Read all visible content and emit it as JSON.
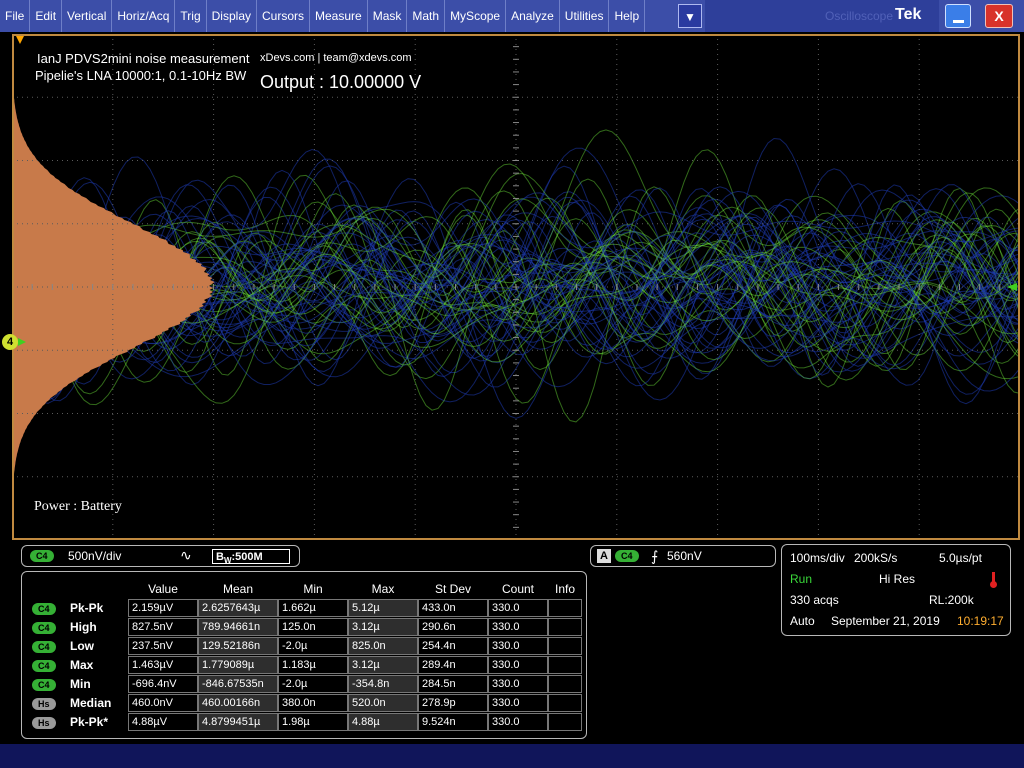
{
  "menu": {
    "items": [
      "File",
      "Edit",
      "Vertical",
      "Horiz/Acq",
      "Trig",
      "Display",
      "Cursors",
      "Measure",
      "Mask",
      "Math",
      "MyScope",
      "Analyze",
      "Utilities",
      "Help"
    ],
    "dropdown_symbol": "▼",
    "ghost_label": "Oscilloscope",
    "logo": "Tek",
    "close_symbol": "X"
  },
  "overlay": {
    "title_line1": "IanJ PDVS2mini noise measurement",
    "title_line2": "Pipelie's LNA 10000:1, 0.1-10Hz BW",
    "credit": "xDevs.com | team@xdevs.com",
    "output": "Output : 10.00000 V",
    "power": "Power : Battery",
    "channel_marker": "4"
  },
  "channel": {
    "chip": "C4",
    "scale": "500nV/div",
    "wave_symbol": "∿",
    "bw_prefix": "B",
    "bw_sub": "W",
    "bw_value": ":500M"
  },
  "trigger": {
    "source_letter": "A",
    "chip": "C4",
    "edge_symbol": "⨍",
    "level": "560nV"
  },
  "acquisition": {
    "timebase": "100ms/div",
    "sample_rate": "200kS/s",
    "per_point": "5.0µs/pt",
    "state": "Run",
    "mode": "Hi Res",
    "acqs": "330 acqs",
    "record_length": "RL:200k",
    "trigger_mode": "Auto",
    "date": "September 21, 2019",
    "time": "10:19:17"
  },
  "measurements": {
    "headers": [
      "Value",
      "Mean",
      "Min",
      "Max",
      "St Dev",
      "Count",
      "Info"
    ],
    "rows": [
      {
        "source": "C4",
        "kind": "c4",
        "name": "Pk-Pk",
        "value": "2.159µV",
        "mean": "2.6257643µ",
        "min": "1.662µ",
        "max": "5.12µ",
        "stdev": "433.0n",
        "count": "330.0",
        "info": ""
      },
      {
        "source": "C4",
        "kind": "c4",
        "name": "High",
        "value": "827.5nV",
        "mean": "789.94661n",
        "min": "125.0n",
        "max": "3.12µ",
        "stdev": "290.6n",
        "count": "330.0",
        "info": ""
      },
      {
        "source": "C4",
        "kind": "c4",
        "name": "Low",
        "value": "237.5nV",
        "mean": "129.52186n",
        "min": "-2.0µ",
        "max": "825.0n",
        "stdev": "254.4n",
        "count": "330.0",
        "info": ""
      },
      {
        "source": "C4",
        "kind": "c4",
        "name": "Max",
        "value": "1.463µV",
        "mean": "1.779089µ",
        "min": "1.183µ",
        "max": "3.12µ",
        "stdev": "289.4n",
        "count": "330.0",
        "info": ""
      },
      {
        "source": "C4",
        "kind": "c4",
        "name": "Min",
        "value": "-696.4nV",
        "mean": "-846.67535n",
        "min": "-2.0µ",
        "max": "-354.8n",
        "stdev": "284.5n",
        "count": "330.0",
        "info": ""
      },
      {
        "source": "Hs",
        "kind": "hs",
        "name": "Median",
        "value": "460.0nV",
        "mean": "460.00166n",
        "min": "380.0n",
        "max": "520.0n",
        "stdev": "278.9p",
        "count": "330.0",
        "info": ""
      },
      {
        "source": "Hs",
        "kind": "hs",
        "name": "Pk-Pk*",
        "value": "4.88µV",
        "mean": "4.8799451µ",
        "min": "1.98µ",
        "max": "4.88µ",
        "stdev": "9.524n",
        "count": "330.0",
        "info": ""
      }
    ]
  },
  "colors": {
    "menubar": "#3c4ea8",
    "graticule_border": "#c08a40",
    "histogram": "#c87a4a",
    "trace_green": "#7cff40",
    "trace_blue": "#1a3aa0",
    "chip_c4": "#35b035",
    "chip_hs": "#9a9a9a",
    "run": "#3ad83a",
    "time": "#ffae30"
  }
}
